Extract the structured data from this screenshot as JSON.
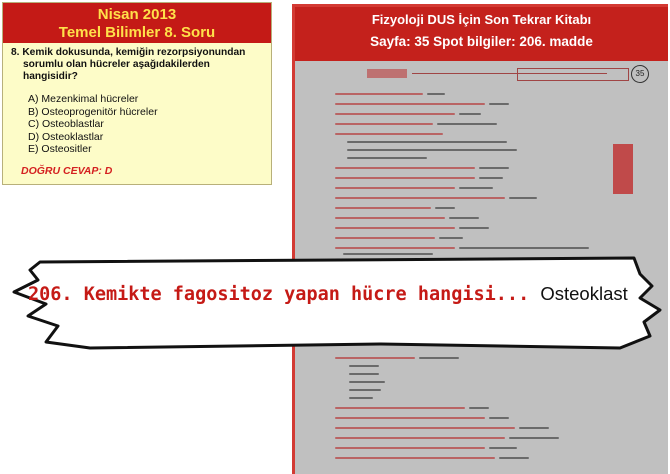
{
  "question_card": {
    "title_line1": "Nisan 2013",
    "title_line2": "Temel Bilimler 8. Soru",
    "question_line1": "8. Kemik dokusunda, kemiğin rezorpsiyonundan",
    "question_line2": "sorumlu olan hücreler aşağıdakilerden hangisidir?",
    "options": [
      "A) Mezenkimal hücreler",
      "B) Osteoprogenitör hücreler",
      "C) Osteoblastlar",
      "D) Osteoklastlar",
      "E) Osteositler"
    ],
    "answer": "DOĞRU CEVAP: D"
  },
  "book_panel": {
    "title": "Fizyoloji DUS İçin Son Tekrar Kitabı",
    "subtitle": "Sayfa: 35 Spot bilgiler: 206. madde",
    "page_number": "35"
  },
  "callout": {
    "question": "206. Kemikte fagositoz yapan hücre hangisi...",
    "answer": "Osteoklast"
  },
  "colors": {
    "header_red": "#c41a16",
    "header_yellow_text": "#ffe14a",
    "card_bg": "#fdfcc8",
    "answer_red": "#d42020",
    "callout_red_text": "#c51a16",
    "page_gray": "#c0c0c0"
  }
}
